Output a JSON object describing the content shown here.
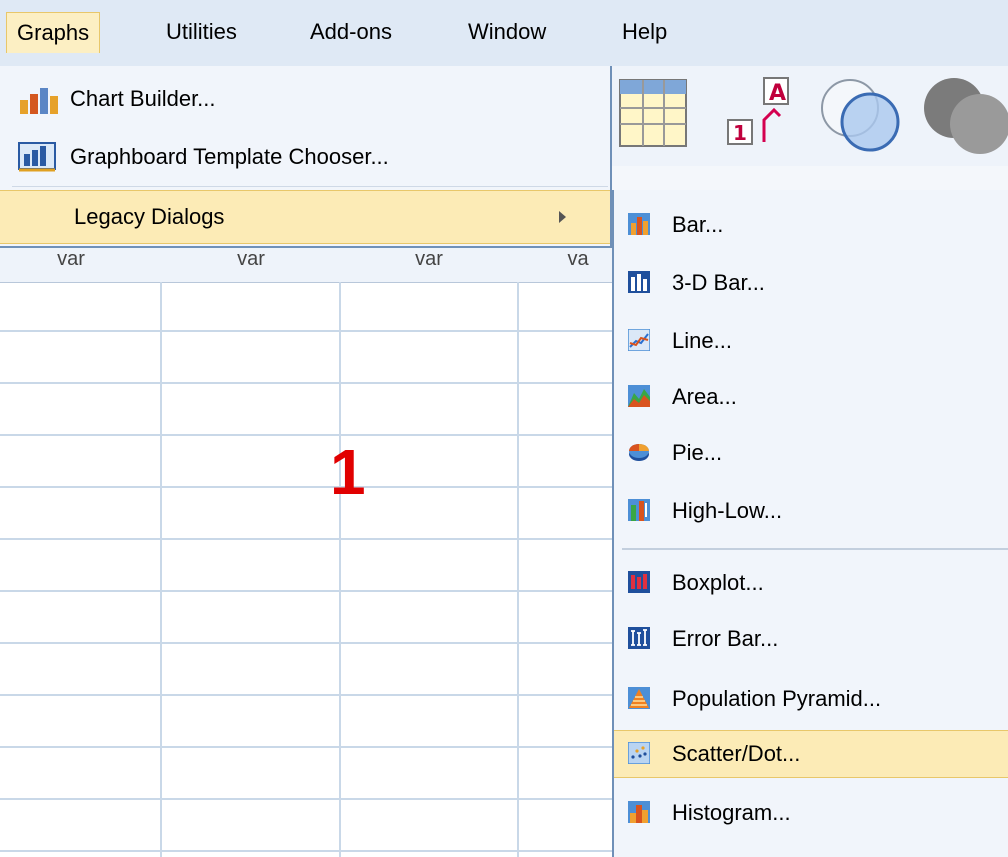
{
  "menubar": {
    "graphs": "Graphs",
    "utilities": "Utilities",
    "addons": "Add-ons",
    "window": "Window",
    "help": "Help"
  },
  "graphs_menu": {
    "chart_builder": "Chart Builder...",
    "template_chooser": "Graphboard Template Chooser...",
    "legacy_dialogs": "Legacy Dialogs"
  },
  "grid": {
    "columns": [
      "var",
      "var",
      "var",
      "va"
    ],
    "overlay_number": "1"
  },
  "legacy_submenu": {
    "items": [
      {
        "label": "Bar...",
        "icon": "bar-chart-icon"
      },
      {
        "label": "3-D Bar...",
        "icon": "3d-bar-chart-icon"
      },
      {
        "label": "Line...",
        "icon": "line-chart-icon"
      },
      {
        "label": "Area...",
        "icon": "area-chart-icon"
      },
      {
        "label": "Pie...",
        "icon": "pie-chart-icon"
      },
      {
        "label": "High-Low...",
        "icon": "high-low-chart-icon"
      },
      {
        "label": "Boxplot...",
        "icon": "boxplot-icon"
      },
      {
        "label": "Error Bar...",
        "icon": "error-bar-icon"
      },
      {
        "label": "Population Pyramid...",
        "icon": "population-pyramid-icon"
      },
      {
        "label": "Scatter/Dot...",
        "icon": "scatter-dot-icon"
      },
      {
        "label": "Histogram...",
        "icon": "histogram-icon"
      }
    ],
    "highlighted": "Scatter/Dot..."
  },
  "colors": {
    "menu_bg": "#dfe9f5",
    "highlight": "#fcebb6",
    "overlay_number": "#e10000"
  }
}
